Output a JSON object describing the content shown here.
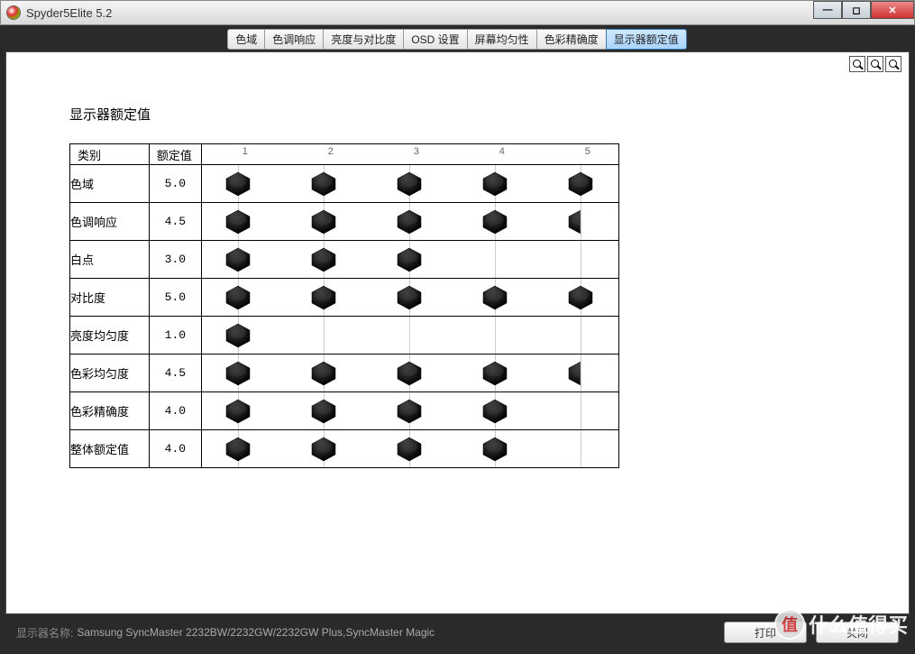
{
  "window": {
    "title": "Spyder5Elite 5.2"
  },
  "tabs": [
    {
      "label": "色域"
    },
    {
      "label": "色调响应"
    },
    {
      "label": "亮度与对比度"
    },
    {
      "label": "OSD 设置"
    },
    {
      "label": "屏幕均匀性"
    },
    {
      "label": "色彩精确度"
    },
    {
      "label": "显示器额定值",
      "active": true
    }
  ],
  "section_title": "显示器额定值",
  "table": {
    "col_category": "类别",
    "col_value": "额定值",
    "scale": [
      1,
      2,
      3,
      4,
      5
    ],
    "rows": [
      {
        "category": "色域",
        "value": "5.0",
        "rating": 5.0
      },
      {
        "category": "色调响应",
        "value": "4.5",
        "rating": 4.5
      },
      {
        "category": "白点",
        "value": "3.0",
        "rating": 3.0
      },
      {
        "category": "对比度",
        "value": "5.0",
        "rating": 5.0
      },
      {
        "category": "亮度均匀度",
        "value": "1.0",
        "rating": 1.0
      },
      {
        "category": "色彩均匀度",
        "value": "4.5",
        "rating": 4.5
      },
      {
        "category": "色彩精确度",
        "value": "4.0",
        "rating": 4.0
      },
      {
        "category": "整体额定值",
        "value": "4.0",
        "rating": 4.0
      }
    ]
  },
  "footer": {
    "monitor_label": "显示器名称:",
    "monitor_value": "Samsung SyncMaster 2232BW/2232GW/2232GW Plus,SyncMaster Magic",
    "print_label": "打印",
    "close_label": "关闭"
  },
  "watermark": {
    "badge": "值",
    "text": "什么值得买"
  },
  "chart_data": {
    "type": "bar",
    "title": "显示器额定值",
    "xlabel": "",
    "ylabel": "额定值",
    "xlim": [
      0,
      5
    ],
    "categories": [
      "色域",
      "色调响应",
      "白点",
      "对比度",
      "亮度均匀度",
      "色彩均匀度",
      "色彩精确度",
      "整体额定值"
    ],
    "values": [
      5.0,
      4.5,
      3.0,
      5.0,
      1.0,
      4.5,
      4.0,
      4.0
    ],
    "ticks": [
      1,
      2,
      3,
      4,
      5
    ]
  }
}
